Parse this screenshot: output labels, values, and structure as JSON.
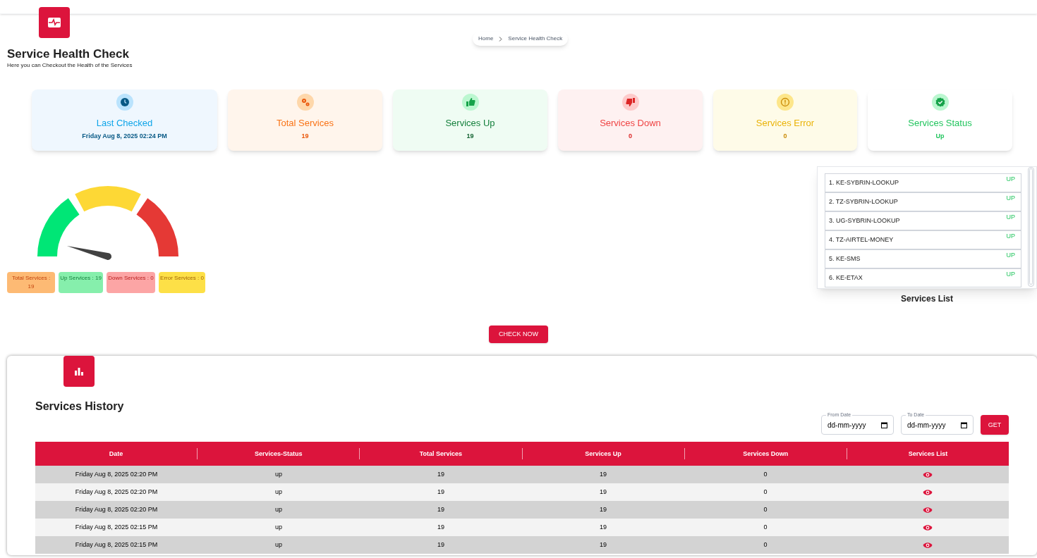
{
  "header": {
    "title": "Service Health Check",
    "subtitle": "Here you can Checkout the Health of the Services"
  },
  "breadcrumb": [
    "Home",
    "Service Health Check"
  ],
  "stats": [
    {
      "kind": "clock",
      "label": "Last Checked",
      "value": "Friday Aug 8, 2025 02:24 PM"
    },
    {
      "kind": "gears",
      "label": "Total Services",
      "value": "19"
    },
    {
      "kind": "thumbs-up",
      "label": "Services Up",
      "value": "19"
    },
    {
      "kind": "thumbs-down",
      "label": "Services Down",
      "value": "0"
    },
    {
      "kind": "alert",
      "label": "Services Error",
      "value": "0"
    },
    {
      "kind": "status",
      "label": "Services Status",
      "value": "Up"
    }
  ],
  "gauge": {
    "level": 0.08
  },
  "legend": [
    {
      "kind": "total",
      "text": "Total Services : 19"
    },
    {
      "kind": "up",
      "text": "Up Services : 19"
    },
    {
      "kind": "down",
      "text": "Down Services : 0"
    },
    {
      "kind": "error",
      "text": "Error Services : 0"
    }
  ],
  "services_list": {
    "title": "Services List",
    "items": [
      {
        "name": "1. KE-SYBRIN-LOOKUP",
        "status": "UP"
      },
      {
        "name": "2. TZ-SYBRIN-LOOKUP",
        "status": "UP"
      },
      {
        "name": "3. UG-SYBRIN-LOOKUP",
        "status": "UP"
      },
      {
        "name": "4. TZ-AIRTEL-MONEY",
        "status": "UP"
      },
      {
        "name": "5. KE-SMS",
        "status": "UP"
      },
      {
        "name": "6. KE-ETAX",
        "status": "UP"
      }
    ]
  },
  "check_button": "CHECK NOW",
  "history": {
    "title": "Services History",
    "from_date": {
      "label": "From Date",
      "placeholder": "dd-mm-yyyy"
    },
    "to_date": {
      "label": "To Date",
      "placeholder": "dd-mm-yyyy"
    },
    "get_button": "GET",
    "columns": [
      "Date",
      "Services-Status",
      "Total Services",
      "Services Up",
      "Services Down",
      "Services List"
    ],
    "rows": [
      [
        "Friday Aug 8, 2025 02:20 PM",
        "up",
        "19",
        "19",
        "0"
      ],
      [
        "Friday Aug 8, 2025 02:20 PM",
        "up",
        "19",
        "19",
        "0"
      ],
      [
        "Friday Aug 8, 2025 02:20 PM",
        "up",
        "19",
        "19",
        "0"
      ],
      [
        "Friday Aug 8, 2025 02:15 PM",
        "up",
        "19",
        "19",
        "0"
      ],
      [
        "Friday Aug 8, 2025 02:15 PM",
        "up",
        "19",
        "19",
        "0"
      ]
    ]
  }
}
